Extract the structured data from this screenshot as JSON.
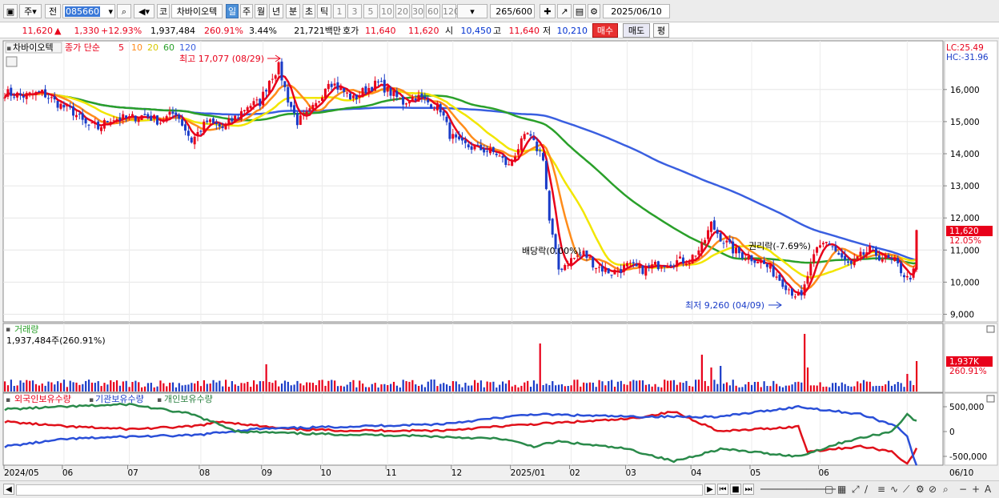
{
  "toolbar": {
    "market_btn": "주",
    "filter_btn": "전",
    "code": "085660",
    "type_btn": "코",
    "name": "차바이오텍",
    "periods": [
      "일",
      "주",
      "월",
      "년",
      "분",
      "초",
      "틱"
    ],
    "selected_period": "일",
    "intervals": [
      "1",
      "3",
      "5",
      "10",
      "20",
      "30",
      "60",
      "120"
    ],
    "count": "265",
    "count_max": "/600",
    "date": "2025/06/10"
  },
  "quote": {
    "price": "11,620",
    "arrow": "▲",
    "change": "1,330",
    "change_pct": "+12.93%",
    "volume": "1,937,484",
    "vol_ratio": "260.91%",
    "turnover": "3.44%",
    "amount": "21,721백만",
    "label_hoga": "호가",
    "ask": "11,640",
    "bid": "11,620",
    "label_open": "시",
    "open": "10,450",
    "label_high": "고",
    "high": "11,640",
    "label_low": "저",
    "low": "10,210",
    "buy_btn": "매수",
    "sell_btn": "매도",
    "eval_btn": "평"
  },
  "price_panel": {
    "name_tag": "차바이오텍",
    "legend_prefix": "종가 단순",
    "ma_labels": [
      "5",
      "10",
      "20",
      "60",
      "120"
    ],
    "lc": "LC:25.49",
    "hc": "HC:-31.96",
    "annot_high": "최고 17,077 (08/29)",
    "annot_low": "최저 9,260 (04/09)",
    "annot_div": "배당락(0.00%)",
    "annot_rights": "권리락(-7.69%)",
    "last_price": "11,620",
    "last_pct": "12.05%"
  },
  "volume_panel": {
    "title": "거래량",
    "info": "1,937,484주(260.91%)",
    "last_vol": "1,937K",
    "last_pct": "260.91%"
  },
  "holding_panel": {
    "legends": [
      "외국인보유수량",
      "기관보유수량",
      "개인보유수량"
    ]
  },
  "colors": {
    "up": "#e8001a",
    "down": "#1a3cc8",
    "ma5": "#e8001a",
    "ma10": "#ff8c1a",
    "ma20": "#f2e600",
    "ma60": "#2aa02a",
    "ma120": "#3a5fe0"
  },
  "chart_data": {
    "type": "line",
    "title": "차바이오텍",
    "y_axis": {
      "ticks": [
        9000,
        10000,
        11000,
        12000,
        13000,
        14000,
        15000,
        16000
      ],
      "tick_labels": [
        "9,000",
        "10,000",
        "11,000",
        "12,000",
        "13,000",
        "14,000",
        "15,000",
        "16,000"
      ],
      "range": [
        8600,
        17400
      ]
    },
    "x_tick_labels": [
      "2024/05",
      "06",
      "07",
      "08",
      "09",
      "10",
      "11",
      "12",
      "2025/01",
      "02",
      "03",
      "04",
      "05",
      "06",
      "06/10"
    ],
    "holding_axis": {
      "ticks": [
        500000,
        0,
        -500000
      ],
      "tick_labels": [
        "500,000",
        "0",
        "-500,000"
      ]
    },
    "close_keypoints": [
      [
        0,
        15900
      ],
      [
        6,
        15800
      ],
      [
        12,
        15900
      ],
      [
        18,
        15500
      ],
      [
        22,
        15300
      ],
      [
        26,
        14900
      ],
      [
        30,
        14800
      ],
      [
        34,
        15100
      ],
      [
        40,
        15100
      ],
      [
        45,
        15200
      ],
      [
        50,
        15000
      ],
      [
        55,
        15300
      ],
      [
        60,
        14400
      ],
      [
        65,
        15000
      ],
      [
        70,
        14800
      ],
      [
        75,
        15200
      ],
      [
        78,
        15500
      ],
      [
        82,
        15600
      ],
      [
        85,
        16300
      ],
      [
        88,
        16700
      ],
      [
        91,
        15700
      ],
      [
        94,
        15000
      ],
      [
        97,
        15200
      ],
      [
        100,
        15500
      ],
      [
        104,
        16300
      ],
      [
        108,
        16000
      ],
      [
        112,
        15700
      ],
      [
        116,
        16000
      ],
      [
        120,
        16200
      ],
      [
        124,
        15900
      ],
      [
        128,
        15600
      ],
      [
        132,
        15800
      ],
      [
        136,
        15600
      ],
      [
        140,
        15400
      ],
      [
        143,
        14600
      ],
      [
        146,
        14300
      ],
      [
        150,
        14200
      ],
      [
        155,
        14100
      ],
      [
        158,
        14000
      ],
      [
        162,
        13600
      ],
      [
        165,
        14200
      ],
      [
        168,
        14600
      ],
      [
        170,
        14300
      ],
      [
        173,
        13900
      ],
      [
        175,
        11900
      ],
      [
        178,
        10400
      ],
      [
        182,
        10700
      ],
      [
        186,
        10900
      ],
      [
        190,
        10500
      ],
      [
        195,
        10300
      ],
      [
        200,
        10500
      ],
      [
        205,
        10400
      ],
      [
        212,
        10600
      ],
      [
        220,
        10700
      ],
      [
        224,
        11100
      ],
      [
        227,
        11800
      ],
      [
        230,
        11400
      ],
      [
        234,
        11000
      ],
      [
        238,
        10800
      ],
      [
        242,
        10700
      ],
      [
        246,
        10400
      ],
      [
        250,
        10000
      ],
      [
        253,
        9700
      ],
      [
        256,
        9500
      ],
      [
        258,
        10200
      ],
      [
        261,
        11000
      ],
      [
        264,
        11300
      ],
      [
        266,
        11100
      ],
      [
        269,
        10700
      ],
      [
        272,
        10500
      ],
      [
        275,
        10800
      ],
      [
        278,
        11000
      ],
      [
        281,
        10800
      ],
      [
        284,
        10700
      ],
      [
        287,
        10500
      ],
      [
        290,
        10100
      ],
      [
        292,
        10300
      ],
      [
        293,
        11620
      ]
    ]
  }
}
